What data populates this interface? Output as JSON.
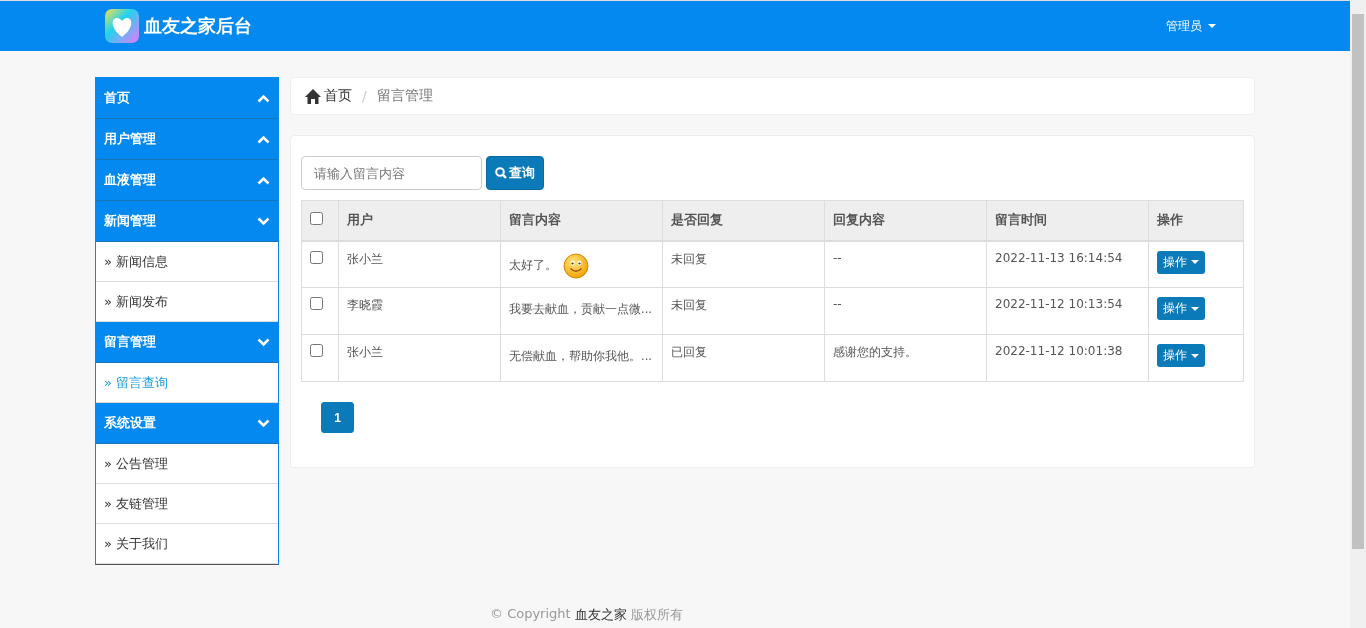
{
  "header": {
    "title": "血友之家后台",
    "user": "管理员"
  },
  "sidebar": {
    "groups": [
      {
        "label": "首页",
        "expanded": false
      },
      {
        "label": "用户管理",
        "expanded": false
      },
      {
        "label": "血液管理",
        "expanded": false
      },
      {
        "label": "新闻管理",
        "expanded": true,
        "children": [
          {
            "marker": "»",
            "label": "新闻信息",
            "selected": false
          },
          {
            "marker": "»",
            "label": "新闻发布",
            "selected": false
          }
        ]
      },
      {
        "label": "留言管理",
        "expanded": true,
        "children": [
          {
            "marker": "»",
            "label": "留言查询",
            "selected": true
          }
        ]
      },
      {
        "label": "系统设置",
        "expanded": true,
        "children": [
          {
            "marker": "»",
            "label": "公告管理",
            "selected": false
          },
          {
            "marker": "»",
            "label": "友链管理",
            "selected": false
          },
          {
            "marker": "»",
            "label": "关于我们",
            "selected": false
          }
        ]
      }
    ]
  },
  "breadcrumb": {
    "separator": "/",
    "items": [
      "首页",
      "留言管理"
    ]
  },
  "search": {
    "placeholder": "请输入留言内容",
    "button": "查询"
  },
  "table": {
    "select_all_checked": false,
    "columns": [
      "用户",
      "留言内容",
      "是否回复",
      "回复内容",
      "留言时间",
      "操作"
    ],
    "rows": [
      {
        "checked": false,
        "user": "张小兰",
        "content": "太好了。",
        "emoji": true,
        "replied": "未回复",
        "reply": "--",
        "time": "2022-11-13 16:14:54",
        "action": "操作"
      },
      {
        "checked": false,
        "user": "李晓霞",
        "content": "我要去献血，贡献一点微...",
        "emoji": false,
        "replied": "未回复",
        "reply": "--",
        "time": "2022-11-12 10:13:54",
        "action": "操作"
      },
      {
        "checked": false,
        "user": "张小兰",
        "content": "无偿献血，帮助你我他。...",
        "emoji": false,
        "replied": "已回复",
        "reply": "感谢您的支持。",
        "time": "2022-11-12 10:01:38",
        "action": "操作"
      }
    ]
  },
  "pagination": [
    {
      "label": "1",
      "selected": true
    }
  ],
  "footer": {
    "prefix": "© Copyright",
    "site": "血友之家",
    "suffix": "版权所有"
  }
}
